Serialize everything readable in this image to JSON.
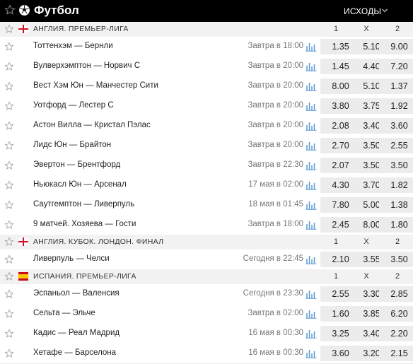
{
  "header": {
    "title": "Футбол",
    "market": "ИСХОДЫ"
  },
  "colors": {
    "header_bg": "#000000",
    "league_bg": "#f2f2f2",
    "odd_bg": "#ececec",
    "stat_icon": "#5b9bd5"
  },
  "columns": [
    "1",
    "X",
    "2"
  ],
  "leagues": [
    {
      "flag": "england",
      "name": "АНГЛИЯ. ПРЕМЬЕР-ЛИГА",
      "matches": [
        {
          "teams": "Тоттенхэм — Бернли",
          "time": "Завтра в 18:00",
          "odds": [
            "1.35",
            "5.10",
            "9.00"
          ]
        },
        {
          "teams": "Вулверхэмптон — Норвич С",
          "time": "Завтра в 20:00",
          "odds": [
            "1.45",
            "4.40",
            "7.20"
          ]
        },
        {
          "teams": "Вест Хэм Юн — Манчестер Сити",
          "time": "Завтра в 20:00",
          "odds": [
            "8.00",
            "5.10",
            "1.37"
          ]
        },
        {
          "teams": "Уотфорд — Лестер С",
          "time": "Завтра в 20:00",
          "odds": [
            "3.80",
            "3.75",
            "1.92"
          ]
        },
        {
          "teams": "Астон Вилла — Кристал Пэлас",
          "time": "Завтра в 20:00",
          "odds": [
            "2.08",
            "3.40",
            "3.60"
          ]
        },
        {
          "teams": "Лидс Юн — Брайтон",
          "time": "Завтра в 20:00",
          "odds": [
            "2.70",
            "3.50",
            "2.55"
          ]
        },
        {
          "teams": "Эвертон — Брентфорд",
          "time": "Завтра в 22:30",
          "odds": [
            "2.07",
            "3.50",
            "3.50"
          ]
        },
        {
          "teams": "Ньюкасл Юн — Арсенал",
          "time": "17 мая в 02:00",
          "odds": [
            "4.30",
            "3.70",
            "1.82"
          ]
        },
        {
          "teams": "Саутгемптон — Ливерпуль",
          "time": "18 мая в 01:45",
          "odds": [
            "7.80",
            "5.00",
            "1.38"
          ]
        },
        {
          "teams": "9 матчей. Хозяева — Гости",
          "time": "Завтра в 18:00",
          "odds": [
            "2.45",
            "8.00",
            "1.80"
          ]
        }
      ]
    },
    {
      "flag": "england",
      "name": "АНГЛИЯ. КУБОК. ЛОНДОН. ФИНАЛ",
      "matches": [
        {
          "teams": "Ливерпуль — Челси",
          "time": "Сегодня в 22:45",
          "odds": [
            "2.10",
            "3.55",
            "3.50"
          ]
        }
      ]
    },
    {
      "flag": "spain",
      "name": "ИСПАНИЯ. ПРЕМЬЕР-ЛИГА",
      "matches": [
        {
          "teams": "Эспаньол — Валенсия",
          "time": "Сегодня в 23:30",
          "odds": [
            "2.55",
            "3.30",
            "2.85"
          ]
        },
        {
          "teams": "Сельта — Эльче",
          "time": "Завтра в 02:00",
          "odds": [
            "1.60",
            "3.85",
            "6.20"
          ]
        },
        {
          "teams": "Кадис — Реал Мадрид",
          "time": "16 мая в 00:30",
          "odds": [
            "3.25",
            "3.40",
            "2.20"
          ]
        },
        {
          "teams": "Хетафе — Барселона",
          "time": "16 мая в 00:30",
          "odds": [
            "3.60",
            "3.20",
            "2.15"
          ]
        }
      ]
    }
  ]
}
